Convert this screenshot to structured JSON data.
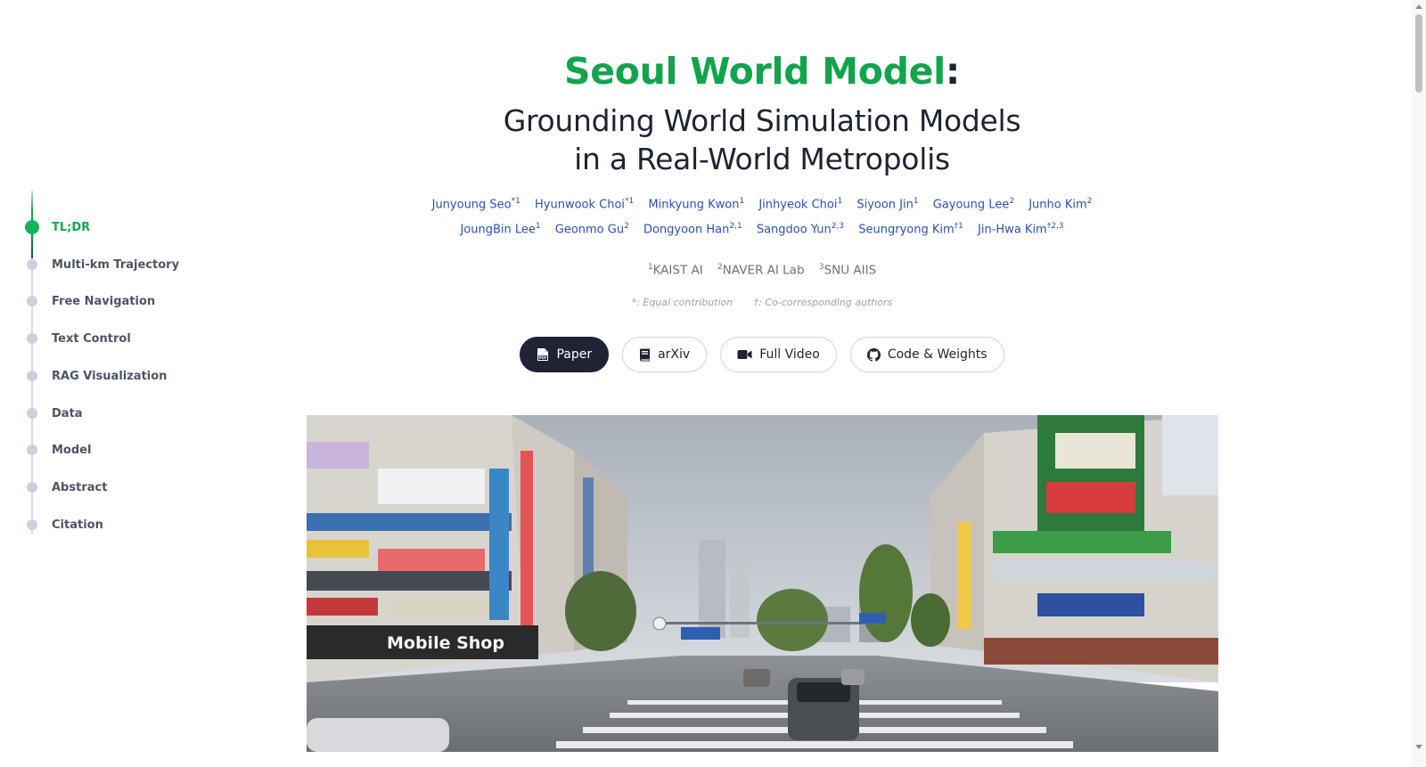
{
  "sidebar": {
    "items": [
      {
        "label": "TL;DR",
        "active": true
      },
      {
        "label": "Multi-km Trajectory",
        "active": false
      },
      {
        "label": "Free Navigation",
        "active": false
      },
      {
        "label": "Text Control",
        "active": false
      },
      {
        "label": "RAG Visualization",
        "active": false
      },
      {
        "label": "Data",
        "active": false
      },
      {
        "label": "Model",
        "active": false
      },
      {
        "label": "Abstract",
        "active": false
      },
      {
        "label": "Citation",
        "active": false
      }
    ]
  },
  "header": {
    "title": "Seoul World Model",
    "title_suffix": ":",
    "subtitle_line1": "Grounding World Simulation Models",
    "subtitle_line2": "in a Real-World Metropolis"
  },
  "authors": {
    "row1": [
      {
        "name": "Junyoung Seo",
        "mark": "*1"
      },
      {
        "name": "Hyunwook Choi",
        "mark": "*1"
      },
      {
        "name": "Minkyung Kwon",
        "mark": "1"
      },
      {
        "name": "Jinhyeok Choi",
        "mark": "1"
      },
      {
        "name": "Siyoon Jin",
        "mark": "1"
      },
      {
        "name": "Gayoung Lee",
        "mark": "2"
      },
      {
        "name": "Junho Kim",
        "mark": "2"
      }
    ],
    "row2": [
      {
        "name": "JoungBin Lee",
        "mark": "1"
      },
      {
        "name": "Geonmo Gu",
        "mark": "2"
      },
      {
        "name": "Dongyoon Han",
        "mark": "2,1"
      },
      {
        "name": "Sangdoo Yun",
        "mark": "2,3"
      },
      {
        "name": "Seungryong Kim",
        "mark": "†1"
      },
      {
        "name": "Jin-Hwa Kim",
        "mark": "†2,3"
      }
    ]
  },
  "affiliations": [
    {
      "mark": "1",
      "name": "KAIST AI"
    },
    {
      "mark": "2",
      "name": "NAVER AI Lab"
    },
    {
      "mark": "3",
      "name": "SNU AIIS"
    }
  ],
  "notes": {
    "equal": "*: Equal contribution",
    "corresponding": "†: Co-corresponding authors"
  },
  "buttons": [
    {
      "label": "Paper",
      "icon": "pdf-icon",
      "style": "dark"
    },
    {
      "label": "arXiv",
      "icon": "book-icon",
      "style": "light"
    },
    {
      "label": "Full Video",
      "icon": "video-camera-icon",
      "style": "light"
    },
    {
      "label": "Code & Weights",
      "icon": "github-icon",
      "style": "light"
    }
  ],
  "hero": {
    "sign_mobile_shop": "Mobile Shop"
  },
  "colors": {
    "accent_green": "#11a44c",
    "text_dark": "#1e2433",
    "author_blue": "#2d4fb5"
  }
}
